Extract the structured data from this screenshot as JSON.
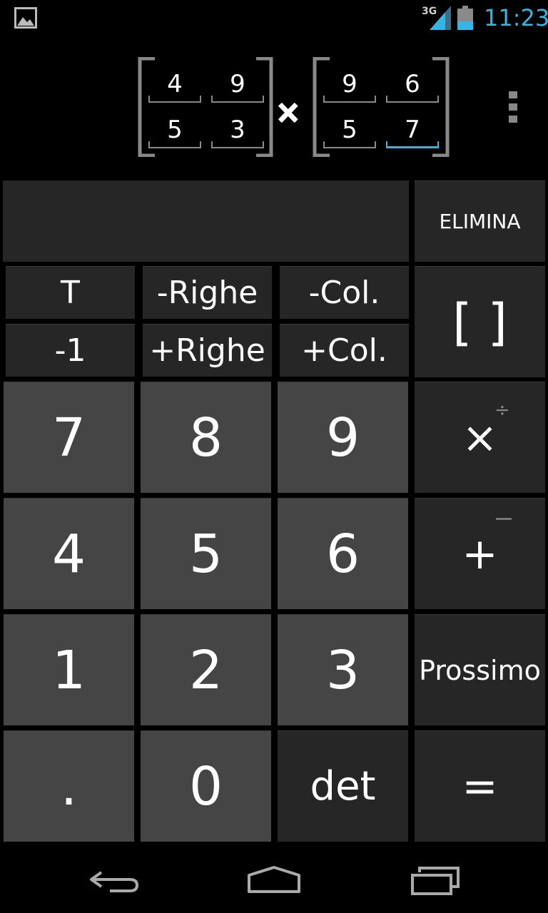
{
  "status_bar": {
    "network": "3G",
    "time": "11:23"
  },
  "matrix_a": {
    "cells": [
      "4",
      "9",
      "5",
      "3"
    ]
  },
  "matrix_b": {
    "cells": [
      "9",
      "6",
      "5",
      "7"
    ]
  },
  "operator": "×",
  "keypad": {
    "elimina": "ELIMINA",
    "brackets": "[ ]",
    "transpose": "T",
    "inverse": "-1",
    "remove_rows": "-Righe",
    "add_rows": "+Righe",
    "remove_cols": "-Col.",
    "add_cols": "+Col.",
    "digits": {
      "d7": "7",
      "d8": "8",
      "d9": "9",
      "d4": "4",
      "d5": "5",
      "d6": "6",
      "d1": "1",
      "d2": "2",
      "d3": "3",
      "d0": "0",
      "dot": "."
    },
    "multiply": "×",
    "divide_alt": "÷",
    "plus": "+",
    "next": "Prossimo",
    "det": "det",
    "equals": "="
  },
  "colors": {
    "accent": "#33b5e5",
    "digit_key": "#454545",
    "function_key": "#262626"
  },
  "icons": {
    "status_picture": "image-notification-icon",
    "signal": "signal-strength-icon",
    "battery": "battery-icon",
    "menu": "overflow-menu-icon",
    "back": "back-icon",
    "home": "home-icon",
    "recents": "recent-apps-icon"
  }
}
